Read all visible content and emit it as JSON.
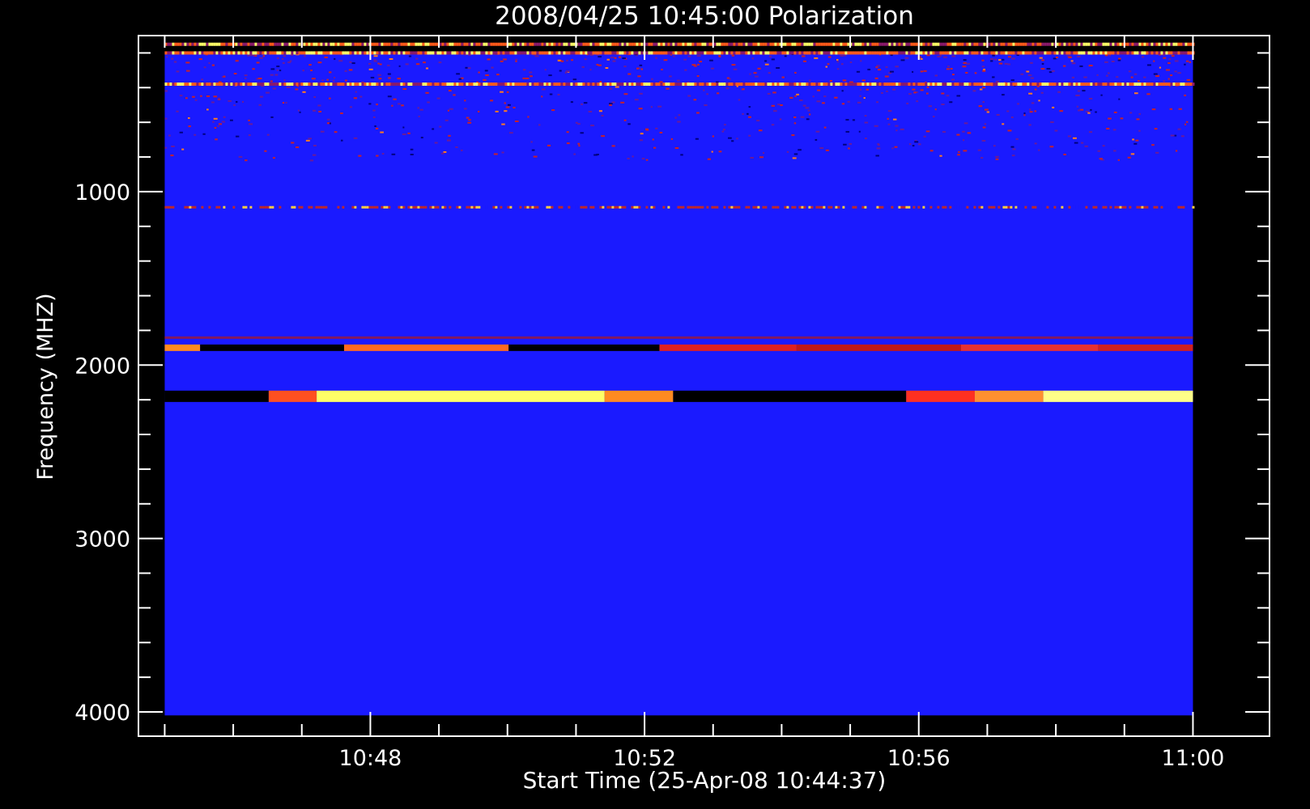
{
  "chart_data": {
    "type": "heatmap",
    "title": "2008/04/25 10:45:00 Polarization",
    "xlabel": "Start Time (25-Apr-08 10:44:37)",
    "ylabel": "Frequency (MHZ)",
    "x_ticks": [
      "10:48",
      "10:52",
      "10:56",
      "11:00"
    ],
    "y_ticks": [
      "1000",
      "2000",
      "3000",
      "4000"
    ],
    "y_tick_values": [
      1000,
      2000,
      3000,
      4000
    ],
    "y_range": [
      4000,
      100
    ],
    "y_minor_step": 200,
    "x_range_minutes": [
      0,
      16.5
    ],
    "x_tick_minutes": [
      3.383,
      7.383,
      11.383,
      15.383
    ],
    "x_minor_minutes": [
      0.383,
      1.383,
      2.383,
      3.383,
      4.383,
      5.383,
      6.383,
      7.383,
      8.383,
      9.383,
      10.383,
      11.383,
      12.383,
      13.383,
      14.383,
      15.383
    ],
    "data_extent_minutes": [
      0.383,
      15.383
    ],
    "data_extent_mhz": [
      100,
      4020
    ],
    "background_color": "#1a1aff",
    "bands": [
      {
        "freq_mhz": 150,
        "level": "strong",
        "extent": "full"
      },
      {
        "freq_mhz": 200,
        "level": "strong",
        "extent": "full"
      },
      {
        "freq_mhz": 380,
        "level": "strong",
        "extent": "full"
      },
      {
        "freq_mhz": 1090,
        "level": "weak",
        "extent": "full"
      },
      {
        "freq_mhz": 1900,
        "level": "medium",
        "extent": "partial"
      },
      {
        "freq_mhz": 2180,
        "level": "strong",
        "extent": "partial"
      }
    ],
    "colors": {
      "background": "#000000",
      "axes": "#ffffff",
      "low": "#1a1aff",
      "mid": "#ff3300",
      "high": "#ffff66"
    },
    "grid": false
  }
}
